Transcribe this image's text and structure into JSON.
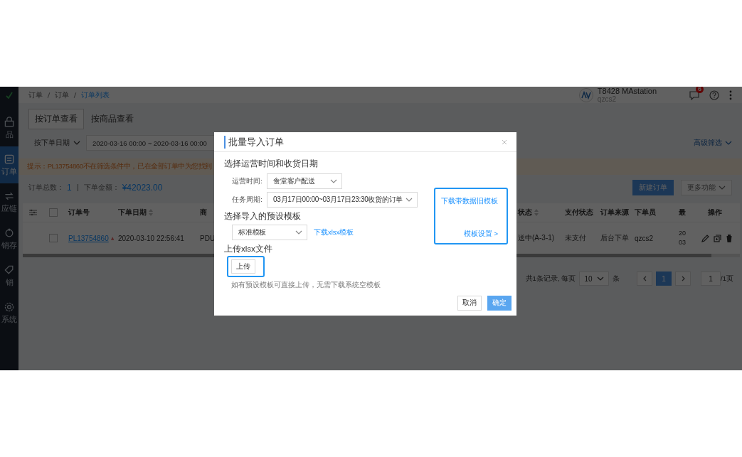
{
  "sidebar": {
    "items": [
      {
        "label": "品",
        "selected": false
      },
      {
        "label": "订单",
        "selected": true
      },
      {
        "label": "应链",
        "selected": false
      },
      {
        "label": "销存",
        "selected": false
      },
      {
        "label": "销",
        "selected": false
      },
      {
        "label": "系统",
        "selected": false
      }
    ]
  },
  "header": {
    "breadcrumb": [
      {
        "label": "订单",
        "selected": false
      },
      {
        "label": "订单",
        "selected": false
      },
      {
        "label": "订单列表",
        "selected": true
      }
    ],
    "account": {
      "name": "T8428 MAstation",
      "user": "qzcs2"
    },
    "notification_count": "6"
  },
  "view_tabs": [
    {
      "label": "按订单查看",
      "selected": true
    },
    {
      "label": "按商品查看",
      "selected": false
    }
  ],
  "filters": {
    "date_type": "按下单日期",
    "date_range": "2020-03-16 00:00 ~ 2020-03-16 00:00",
    "advanced": "高级筛选"
  },
  "notice": "提示：PL13754860不在筛选条件中，已在全部订单中为您找到",
  "summary": {
    "count_label": "订单总数：",
    "count": "1",
    "amount_label": "下单金额：",
    "amount": "¥42023.00"
  },
  "actions": [
    {
      "label": "新建订单",
      "kind": "primary"
    },
    {
      "label": "更多功能",
      "kind": "menu"
    }
  ],
  "table": {
    "select_all_checked": false,
    "columns": [
      {
        "label": "订单号",
        "sortable": false
      },
      {
        "label": "下单日期",
        "sortable": true
      },
      {
        "label": "商",
        "sortable": false
      },
      {
        "label": "状态",
        "sortable": true
      },
      {
        "label": "支付状态",
        "sortable": false
      },
      {
        "label": "订单来源",
        "sortable": false
      },
      {
        "label": "下单员",
        "sortable": false
      },
      {
        "label": "最",
        "sortable": false
      },
      {
        "label": "操作",
        "sortable": false
      }
    ],
    "rows": [
      {
        "checked": false,
        "warning": true,
        "cells": [
          "PL13754860",
          "2020-03-10 22:56:41",
          "PDU",
          "送中(A-3-1)",
          "未支付",
          "后台下单",
          "qzcs2",
          "20\n03"
        ]
      }
    ]
  },
  "pagination": {
    "total": "共1条记录, 每页",
    "page_size": "10",
    "unit": "条",
    "pages": [
      {
        "label": "1",
        "selected": true
      }
    ],
    "jump": "1",
    "page_count": "/1页"
  },
  "dialog": {
    "title": "批量导入订单",
    "section_1": "选择运营时间和收货日期",
    "fields": [
      {
        "label": "运营时间:",
        "value": "食堂客户配送"
      },
      {
        "label": "任务周期:",
        "value": "03月17日00:00~03月17日23:30收货的订单"
      }
    ],
    "old_template": {
      "highlighted": true,
      "download": "下载带数据旧模板",
      "settings": "模板设置 >"
    },
    "section_2": "选择导入的预设模板",
    "template": "标准模板",
    "template_download": "下载xlsx模板",
    "section_3": "上传xlsx文件",
    "upload": {
      "label": "上传",
      "highlighted": true
    },
    "hint": "如有预设模板可直接上传，无需下载系统空模板",
    "buttons": [
      {
        "label": "取消",
        "kind": "secondary"
      },
      {
        "label": "确定",
        "kind": "primary"
      }
    ]
  }
}
